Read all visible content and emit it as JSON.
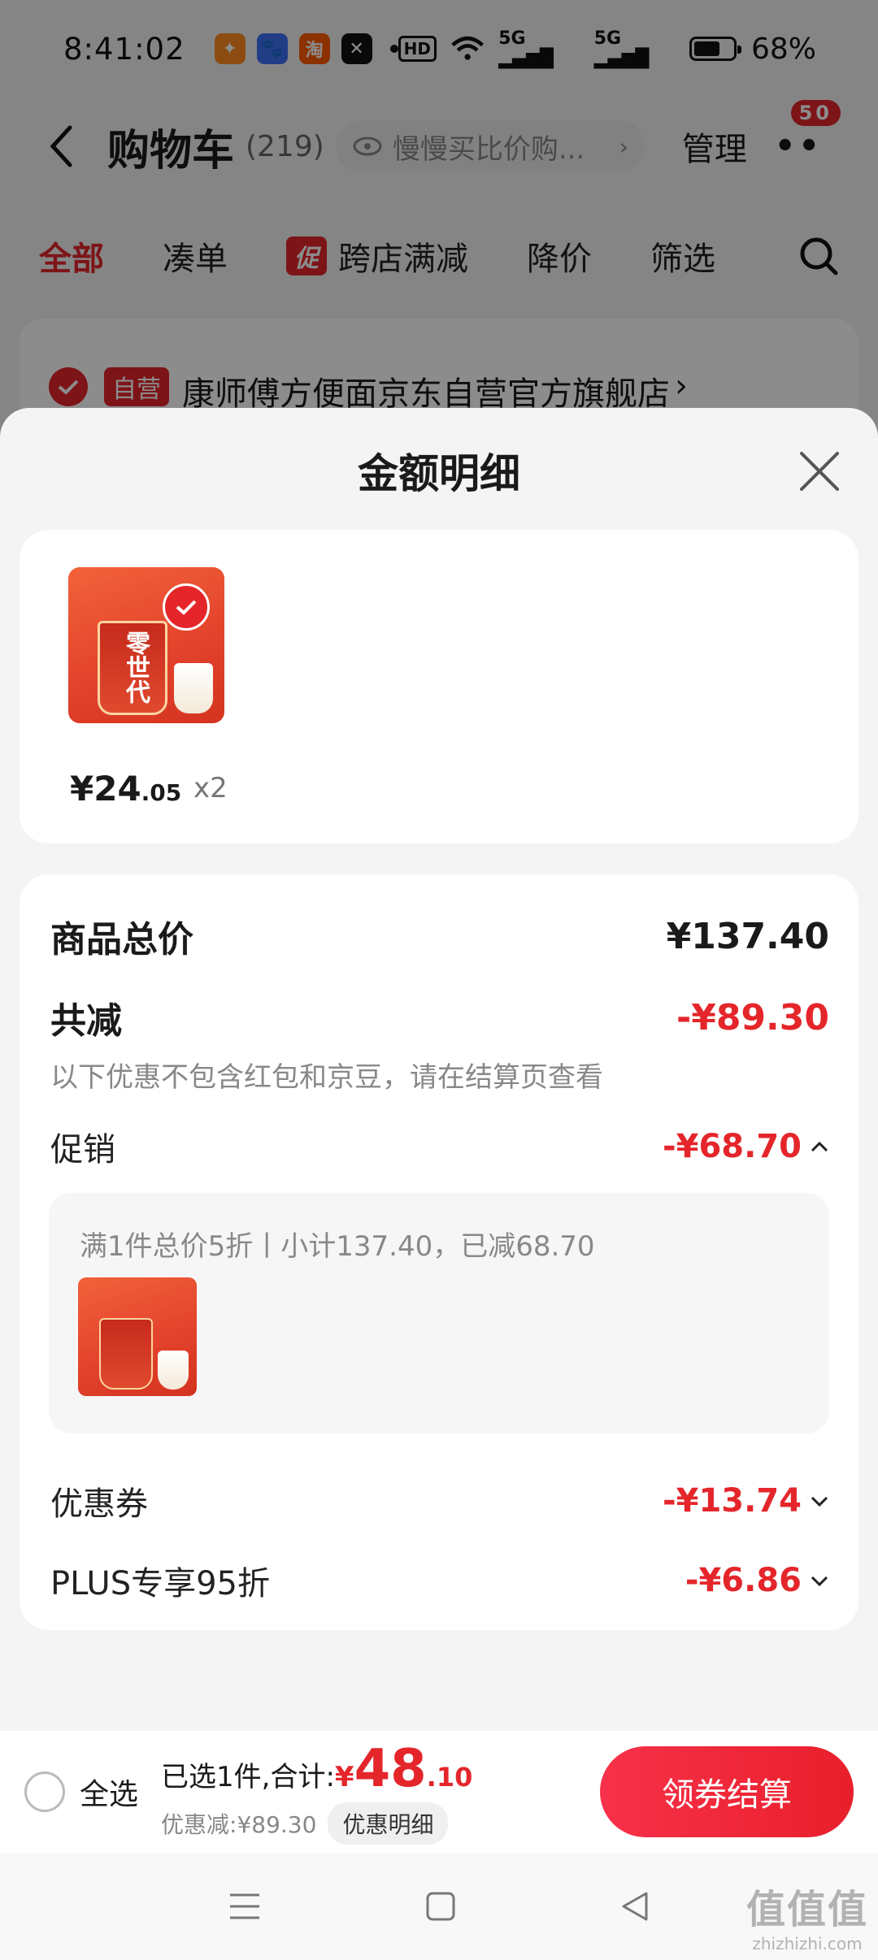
{
  "status_bar": {
    "time": "8:41:02",
    "hd": "HD",
    "net1": "5G",
    "net2": "5G",
    "battery": "68%",
    "battery_level": 0.68,
    "app_taobao": "淘"
  },
  "nav": {
    "title": "购物车",
    "count": "(219)",
    "search_placeholder": "慢慢买比价购...",
    "manage": "管理",
    "badge": "50"
  },
  "tabs": [
    {
      "label": "全部",
      "active": true
    },
    {
      "label": "凑单"
    },
    {
      "label": "跨店满减",
      "tag": "促"
    },
    {
      "label": "降价"
    },
    {
      "label": "筛选"
    }
  ],
  "store": {
    "tag": "自营",
    "name": "康师傅方便面京东自营官方旗舰店",
    "arrow": "›"
  },
  "sheet": {
    "title": "金额明细",
    "product": {
      "brand_text": "零世代",
      "price_int": "¥24",
      "price_dec": ".05",
      "qty": "x2"
    },
    "summary": {
      "total_label": "商品总价",
      "total_value": "¥137.40",
      "reduce_label": "共减",
      "reduce_value": "-¥89.30",
      "note": "以下优惠不包含红包和京豆，请在结算页查看",
      "promo_label": "促销",
      "promo_value": "-¥68.70",
      "promo_detail": "满1件总价5折丨小计137.40，已减68.70",
      "coupon_label": "优惠券",
      "coupon_value": "-¥13.74",
      "plus_label": "PLUS专享95折",
      "plus_value": "-¥6.86"
    }
  },
  "bottom": {
    "select_all": "全选",
    "selected_text": "已选1件,合计:",
    "total_yen": "¥",
    "total_int": "48",
    "total_dec": ".10",
    "discount_text": "优惠减:¥89.30",
    "detail_button": "优惠明细",
    "checkout": "领券结算"
  },
  "watermark": {
    "big": "值值值",
    "small": "zhizhizhi.com"
  },
  "colors": {
    "accent": "#e4262b",
    "checkout_start": "#f8314a",
    "checkout_end": "#e81f2b"
  }
}
